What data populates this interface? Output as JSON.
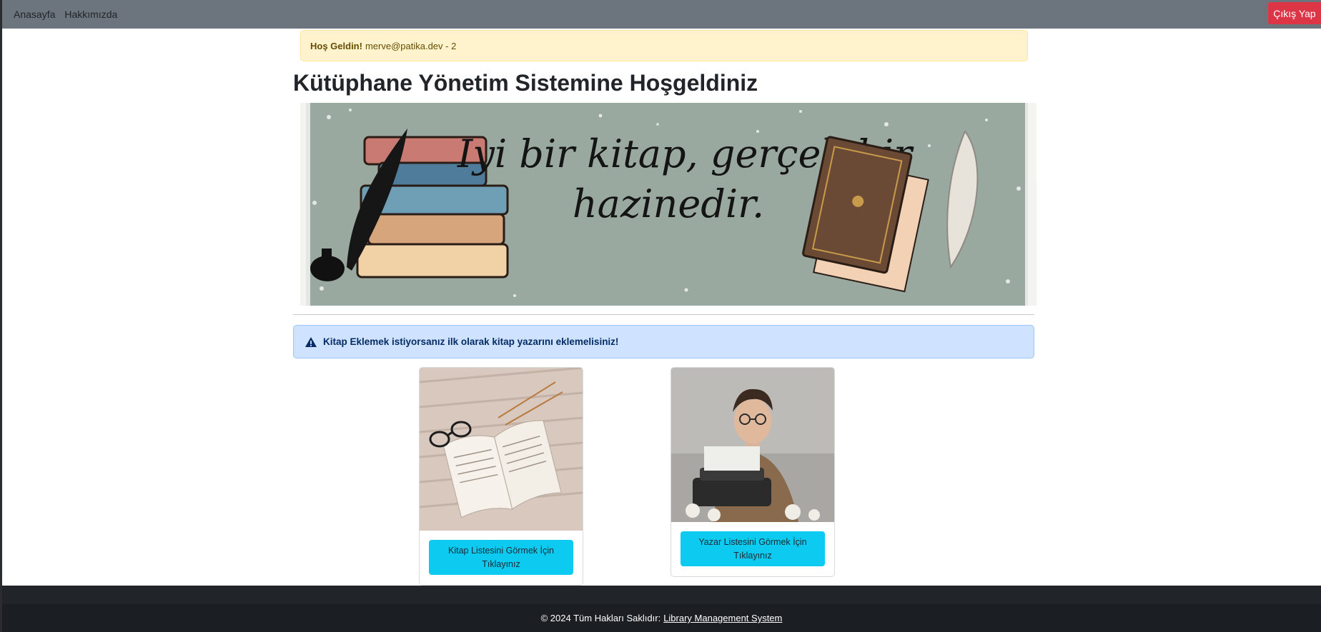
{
  "navbar": {
    "links": [
      "Anasayfa",
      "Hakkımızda"
    ],
    "logout_label": "Çıkış Yap"
  },
  "welcome": {
    "greeting": "Hoş Geldin!",
    "user": "merve@patika.dev - 2"
  },
  "page_title": "Kütüphane Yönetim Sistemine Hoşgeldiniz",
  "banner": {
    "quote_line1": "Iyi bir kitap, gerçek bir",
    "quote_line2": "hazinedir."
  },
  "info_alert": {
    "icon": "warning-triangle-icon",
    "text": "Kitap Eklemek istiyorsanız ilk olarak kitap yazarını eklemelisiniz!"
  },
  "cards": [
    {
      "image": "open-book-photo",
      "button_line1": "Kitap Listesini Görmek İçin",
      "button_line2": "Tıklayınız"
    },
    {
      "image": "writer-typewriter-photo",
      "button_line1": "Yazar Listesini Görmek İçin",
      "button_line2": "Tıklayınız"
    }
  ],
  "footer": {
    "text": "© 2024 Tüm Hakları Saklıdır:",
    "link": "Library Management System"
  },
  "colors": {
    "navbar": "#6c757d",
    "danger": "#dc3545",
    "info_button": "#0dcaf0",
    "warning_bg": "#fff3cd",
    "primary_alert_bg": "#cfe2ff",
    "footer": "#1b1f23"
  }
}
